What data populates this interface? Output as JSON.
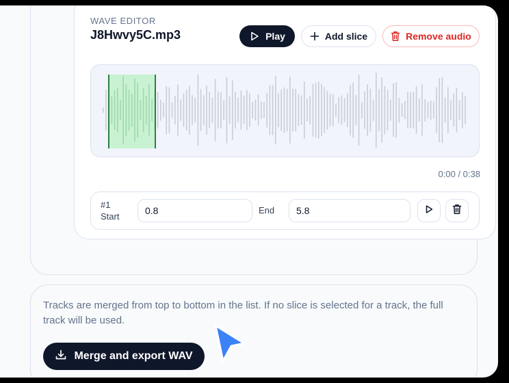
{
  "editor": {
    "kicker": "WAVE EDITOR",
    "filename": "J8Hwvy5C.mp3",
    "buttons": {
      "play": "Play",
      "add_slice": "Add slice",
      "remove_audio": "Remove audio"
    },
    "timecode": "0:00 / 0:38",
    "selection_fraction": [
      0.045,
      0.165
    ],
    "colors": {
      "dark": "#0f172a",
      "danger": "#dc2626",
      "selection": "#c9f2d2",
      "selection_edge": "#2f7d46",
      "bars": "#c9cdd4"
    }
  },
  "slices": [
    {
      "number": "#1",
      "start_label": "Start",
      "start_value": "0.8",
      "end_label": "End",
      "end_value": "5.8"
    }
  ],
  "merge": {
    "description": "Tracks are merged from top to bottom in the list. If no slice is selected for a track, the full track will be used.",
    "button_label": "Merge and export WAV"
  },
  "icons": [
    "play-icon",
    "plus-icon",
    "trash-icon",
    "download-icon",
    "mouse-cursor-icon"
  ]
}
